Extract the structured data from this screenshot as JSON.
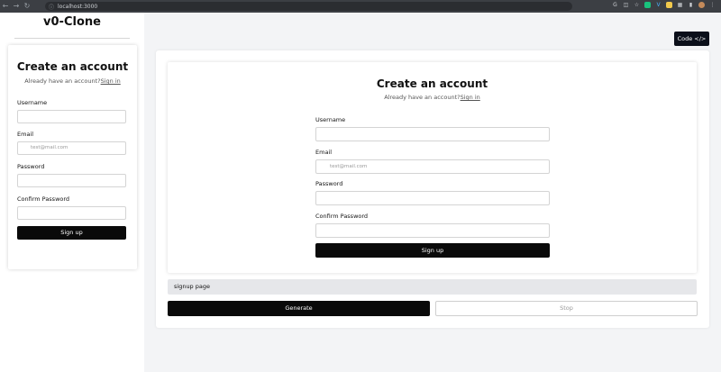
{
  "browser": {
    "url": "localhost:3000"
  },
  "sidebar": {
    "brand": "v0-Clone",
    "form": {
      "title": "Create an account",
      "subtitle": "Already have an account?",
      "signin_link": "Sign in",
      "username_label": "Username",
      "email_label": "Email",
      "email_placeholder": "test@mail.com",
      "password_label": "Password",
      "confirm_label": "Confirm Password",
      "signup_button": "Sign up"
    }
  },
  "toolbar": {
    "code_button": "Code </>"
  },
  "preview": {
    "title": "Create an account",
    "subtitle": "Already have an account?",
    "signin_link": "Sign in",
    "username_label": "Username",
    "email_label": "Email",
    "email_placeholder": "test@mail.com",
    "password_label": "Password",
    "confirm_label": "Confirm Password",
    "signup_button": "Sign up"
  },
  "prompt": {
    "value": "signup page"
  },
  "actions": {
    "generate": "Generate",
    "stop": "Stop"
  },
  "colors": {
    "accent": "#0a0a0a",
    "page_background": "#f3f4f6",
    "chrome": "#3c3f44"
  }
}
